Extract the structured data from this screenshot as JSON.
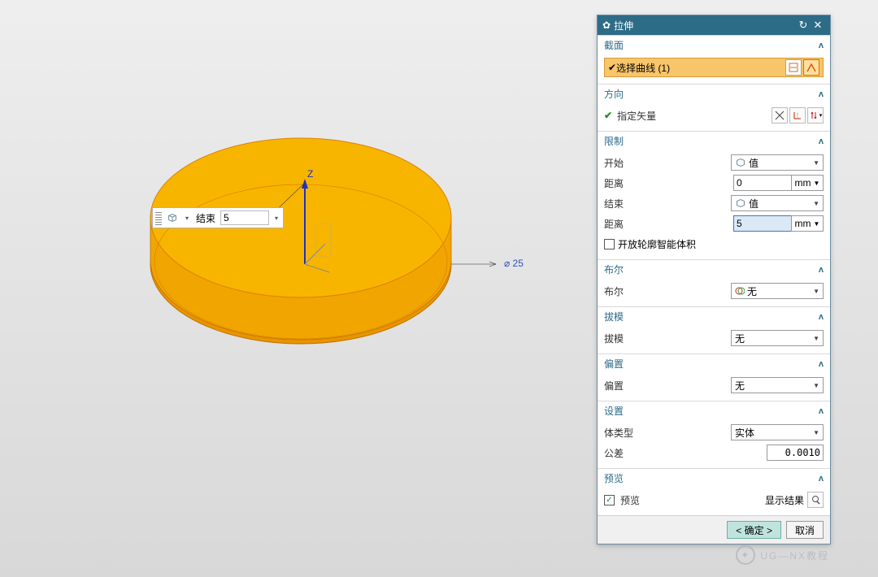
{
  "title": "拉伸",
  "viewport": {
    "diameter_label": "⌀ 25",
    "axis_z": "Z"
  },
  "floatbar": {
    "label": "结束",
    "value": "5"
  },
  "sections": {
    "section": {
      "title": "截面",
      "select_label": "选择曲线 (1)"
    },
    "direction": {
      "title": "方向",
      "vector_label": "指定矢量"
    },
    "limit": {
      "title": "限制",
      "start": "开始",
      "start_val": "值",
      "dist1": "距离",
      "dist1_val": "0",
      "unit1": "mm",
      "end": "结束",
      "end_val": "值",
      "dist2": "距离",
      "dist2_val": "5",
      "unit2": "mm",
      "open_check": "开放轮廓智能体积"
    },
    "boolean": {
      "title": "布尔",
      "label": "布尔",
      "value": "无"
    },
    "draft": {
      "title": "拔模",
      "label": "拔模",
      "value": "无"
    },
    "offset": {
      "title": "偏置",
      "label": "偏置",
      "value": "无"
    },
    "settings": {
      "title": "设置",
      "body_type": "体类型",
      "body_val": "实体",
      "tol": "公差",
      "tol_val": "0.0010"
    },
    "preview": {
      "title": "预览",
      "check_label": "预览",
      "result_btn": "显示结果"
    }
  },
  "footer": {
    "ok": "< 确定 >",
    "cancel": "取消"
  },
  "watermark": "UG—NX教程"
}
